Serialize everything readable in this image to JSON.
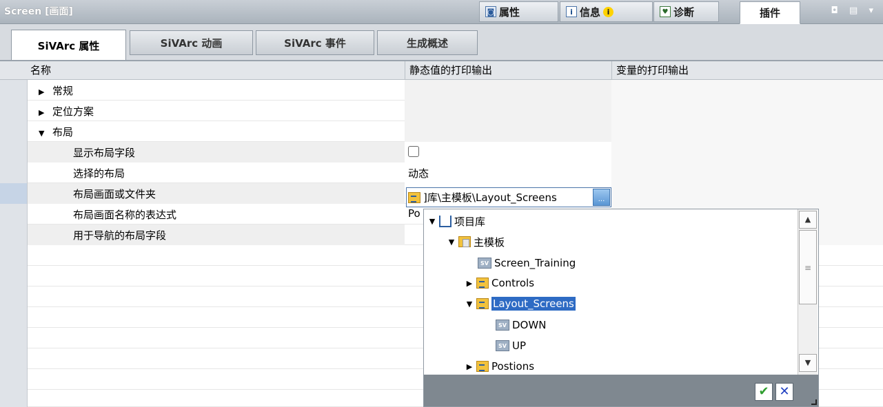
{
  "window": {
    "title": "Screen [画面]"
  },
  "panel_tabs": [
    {
      "label": "属性",
      "icon": "properties-icon"
    },
    {
      "label": "信息",
      "icon": "info-icon",
      "badge": "i"
    },
    {
      "label": "诊断",
      "icon": "diagnostics-icon"
    },
    {
      "label": "插件",
      "active": true
    }
  ],
  "window_controls": "◘ ▤ ▾",
  "sub_tabs": [
    {
      "label": "SiVArc 属性",
      "active": true
    },
    {
      "label": "SiVArc 动画"
    },
    {
      "label": "SiVArc 事件"
    },
    {
      "label": "生成概述"
    }
  ],
  "grid": {
    "columns": [
      "名称",
      "静态值的打印输出",
      "变量的打印输出"
    ],
    "rows": [
      {
        "name": "常规",
        "expander": "collapsed"
      },
      {
        "name": "定位方案",
        "expander": "collapsed"
      },
      {
        "name": "布局",
        "expander": "expanded"
      },
      {
        "name": "显示布局字段",
        "static_value": "checkbox-unchecked"
      },
      {
        "name": "选择的布局",
        "static_value": "动态"
      },
      {
        "name": "布局画面或文件夹",
        "static_value": "]库\\主模板\\Layout_Screens"
      },
      {
        "name": "布局画面名称的表达式",
        "static_value": "Po"
      },
      {
        "name": "用于导航的布局字段"
      }
    ]
  },
  "browse_button": "...",
  "tree": {
    "nodes": [
      {
        "label": "项目库",
        "icon": "project-library-icon",
        "expander": "expanded"
      },
      {
        "label": "主模板",
        "icon": "master-copies-folder-icon",
        "expander": "expanded"
      },
      {
        "label": "Screen_Training",
        "icon": "screen-icon"
      },
      {
        "label": "Controls",
        "icon": "library-folder-icon",
        "expander": "collapsed"
      },
      {
        "label": "Layout_Screens",
        "icon": "library-folder-icon",
        "expander": "expanded",
        "selected": true
      },
      {
        "label": "DOWN",
        "icon": "screen-icon"
      },
      {
        "label": "UP",
        "icon": "screen-icon"
      },
      {
        "label": "Postions",
        "icon": "library-folder-icon",
        "expander": "collapsed"
      }
    ],
    "screen_icon_text": "SV"
  },
  "popup_buttons": {
    "ok": "✔",
    "cancel": "✕"
  },
  "colors": {
    "accent": "#2e6bc4",
    "ok_green": "#2f9e2f",
    "cancel_blue": "#2040c0"
  }
}
